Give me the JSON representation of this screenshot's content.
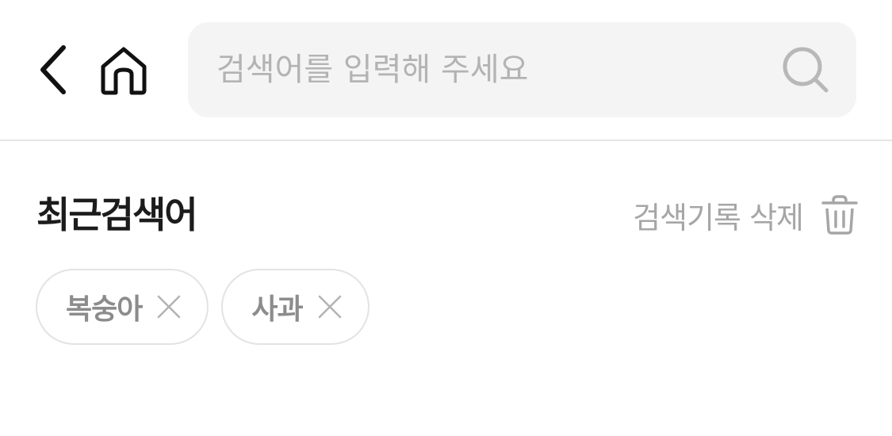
{
  "header": {
    "search": {
      "placeholder": "검색어를 입력해 주세요",
      "value": ""
    }
  },
  "recent": {
    "title": "최근검색어",
    "clear_label": "검색기록 삭제",
    "items": [
      {
        "label": "복숭아"
      },
      {
        "label": "사과"
      }
    ]
  },
  "icons": {
    "back": "chevron-left-icon",
    "home": "home-icon",
    "search": "search-icon",
    "trash": "trash-icon",
    "remove": "close-icon"
  },
  "colors": {
    "search_bg": "#f4f4f4",
    "placeholder": "#b3b3b3",
    "muted_text": "#a6a6a6",
    "chip_border": "#e3e3e3",
    "title": "#1c1c1c"
  }
}
